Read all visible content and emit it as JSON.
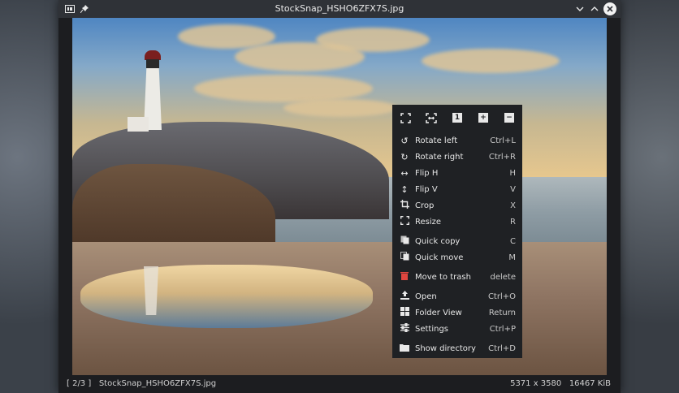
{
  "window": {
    "title": "StockSnap_HSHO6ZFX7S.jpg"
  },
  "titlebar_icons": [
    "app-icon",
    "pin-icon"
  ],
  "window_controls": {
    "minimize": "v",
    "maximize": "^",
    "close": "x"
  },
  "menu": {
    "top_icons": [
      "fit-window-icon",
      "fit-width-icon",
      "original-size-icon",
      "zoom-in-icon",
      "zoom-out-icon"
    ],
    "items": [
      {
        "label": "Rotate left",
        "shortcut": "Ctrl+L",
        "icon": "rotate-left-icon"
      },
      {
        "label": "Rotate right",
        "shortcut": "Ctrl+R",
        "icon": "rotate-right-icon"
      },
      {
        "label": "Flip H",
        "shortcut": "H",
        "icon": "flip-h-icon"
      },
      {
        "label": "Flip V",
        "shortcut": "V",
        "icon": "flip-v-icon"
      },
      {
        "label": "Crop",
        "shortcut": "X",
        "icon": "crop-icon"
      },
      {
        "label": "Resize",
        "shortcut": "R",
        "icon": "resize-icon"
      },
      {
        "label": "Quick copy",
        "shortcut": "C",
        "icon": "copy-icon"
      },
      {
        "label": "Quick move",
        "shortcut": "M",
        "icon": "move-icon"
      },
      {
        "label": "Move to trash",
        "shortcut": "delete",
        "icon": "trash-icon"
      },
      {
        "label": "Open",
        "shortcut": "Ctrl+O",
        "icon": "open-icon"
      },
      {
        "label": "Folder View",
        "shortcut": "Return",
        "icon": "folder-view-icon"
      },
      {
        "label": "Settings",
        "shortcut": "Ctrl+P",
        "icon": "settings-icon"
      },
      {
        "label": "Show directory",
        "shortcut": "Ctrl+D",
        "icon": "folder-icon"
      }
    ]
  },
  "status": {
    "position": "[ 2/3 ]",
    "filename": "StockSnap_HSHO6ZFX7S.jpg",
    "resolution": "5371 x 3580",
    "size": "16467 KiB"
  },
  "colors": {
    "titlebar": "#2f3237",
    "menu_bg": "#1f2124",
    "trash": "#e0463f"
  }
}
